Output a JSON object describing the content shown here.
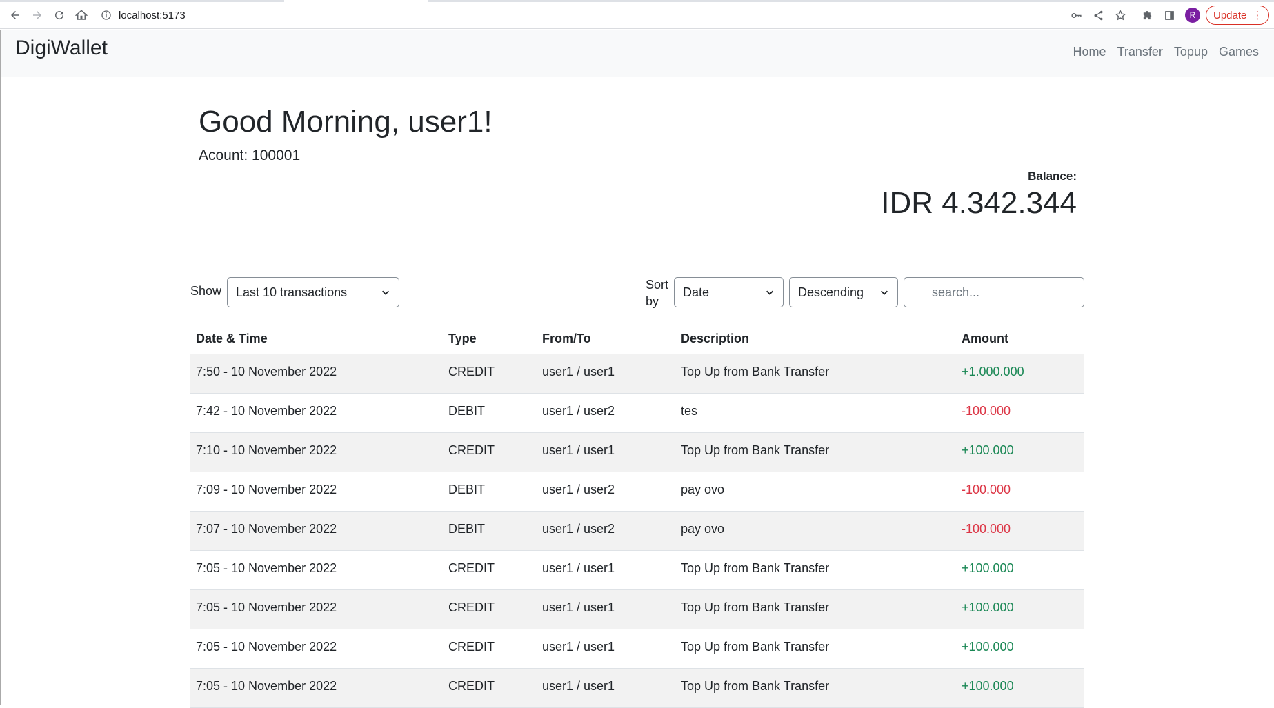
{
  "browser": {
    "url": "localhost:5173",
    "avatar_letter": "R",
    "update_label": "Update"
  },
  "navbar": {
    "brand": "DigiWallet",
    "links": [
      "Home",
      "Transfer",
      "Topup",
      "Games"
    ]
  },
  "greeting": {
    "title": "Good Morning, user1!",
    "account": "Acount: 100001",
    "balance_label": "Balance:",
    "balance_value": "IDR 4.342.344"
  },
  "controls": {
    "show_label": "Show",
    "show_value": "Last 10 transactions",
    "sort_label": "Sort by",
    "sort_field": "Date",
    "sort_order": "Descending",
    "search_placeholder": "search..."
  },
  "table": {
    "headers": [
      "Date & Time",
      "Type",
      "From/To",
      "Description",
      "Amount"
    ],
    "rows": [
      {
        "date": "7:50 - 10 November 2022",
        "type": "CREDIT",
        "from_to": "user1 / user1",
        "description": "Top Up from Bank Transfer",
        "amount": "+1.000.000"
      },
      {
        "date": "7:42 - 10 November 2022",
        "type": "DEBIT",
        "from_to": "user1 / user2",
        "description": "tes",
        "amount": "-100.000"
      },
      {
        "date": "7:10 - 10 November 2022",
        "type": "CREDIT",
        "from_to": "user1 / user1",
        "description": "Top Up from Bank Transfer",
        "amount": "+100.000"
      },
      {
        "date": "7:09 - 10 November 2022",
        "type": "DEBIT",
        "from_to": "user1 / user2",
        "description": "pay ovo",
        "amount": "-100.000"
      },
      {
        "date": "7:07 - 10 November 2022",
        "type": "DEBIT",
        "from_to": "user1 / user2",
        "description": "pay ovo",
        "amount": "-100.000"
      },
      {
        "date": "7:05 - 10 November 2022",
        "type": "CREDIT",
        "from_to": "user1 / user1",
        "description": "Top Up from Bank Transfer",
        "amount": "+100.000"
      },
      {
        "date": "7:05 - 10 November 2022",
        "type": "CREDIT",
        "from_to": "user1 / user1",
        "description": "Top Up from Bank Transfer",
        "amount": "+100.000"
      },
      {
        "date": "7:05 - 10 November 2022",
        "type": "CREDIT",
        "from_to": "user1 / user1",
        "description": "Top Up from Bank Transfer",
        "amount": "+100.000"
      },
      {
        "date": "7:05 - 10 November 2022",
        "type": "CREDIT",
        "from_to": "user1 / user1",
        "description": "Top Up from Bank Transfer",
        "amount": "+100.000"
      }
    ]
  },
  "colors": {
    "credit_amount": "#198754",
    "debit_amount": "#dc3545",
    "navbar_bg": "#f8f9fa",
    "row_stripe": "#f2f2f2"
  }
}
